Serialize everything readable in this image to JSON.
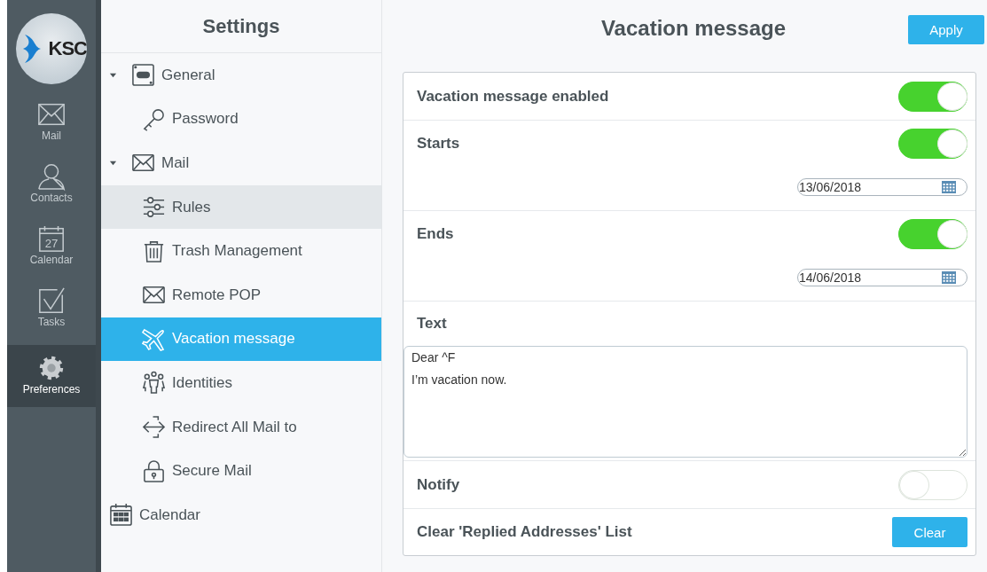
{
  "rail": {
    "logo": "KSC",
    "items": [
      {
        "label": "Mail",
        "kind": "mail",
        "selected": false
      },
      {
        "label": "Contacts",
        "kind": "person",
        "selected": false
      },
      {
        "label": "Calendar",
        "kind": "calendar",
        "day": "27",
        "selected": false
      },
      {
        "label": "Tasks",
        "kind": "check",
        "selected": false
      },
      {
        "label": "Preferences",
        "kind": "gear",
        "selected": true
      }
    ]
  },
  "settings": {
    "title": "Settings",
    "tree": [
      {
        "label": "General",
        "kind": "switch",
        "expanded": true,
        "selected": false,
        "hovered": false,
        "children": [
          {
            "label": "Password",
            "kind": "key",
            "selected": false,
            "hovered": false
          }
        ]
      },
      {
        "label": "Mail",
        "kind": "mail",
        "expanded": true,
        "selected": false,
        "hovered": false,
        "children": [
          {
            "label": "Rules",
            "kind": "sliders",
            "selected": false,
            "hovered": true
          },
          {
            "label": "Trash Management",
            "kind": "trash",
            "selected": false,
            "hovered": false
          },
          {
            "label": "Remote POP",
            "kind": "mail",
            "selected": false,
            "hovered": false
          },
          {
            "label": "Vacation message",
            "kind": "plane",
            "selected": true,
            "hovered": false
          },
          {
            "label": "Identities",
            "kind": "people",
            "selected": false,
            "hovered": false
          },
          {
            "label": "Redirect All Mail to",
            "kind": "arrows",
            "selected": false,
            "hovered": false
          },
          {
            "label": "Secure Mail",
            "kind": "lock",
            "selected": false,
            "hovered": false
          }
        ]
      },
      {
        "label": "Calendar",
        "kind": "grid",
        "selected": false,
        "hovered": false
      }
    ]
  },
  "main": {
    "title": "Vacation message",
    "apply": "Apply",
    "rows": [
      {
        "kind": "toggle",
        "label": "Vacation message enabled",
        "on": true
      },
      {
        "kind": "toggle-date",
        "label": "Starts",
        "on": true,
        "date": "13/06/2018"
      },
      {
        "kind": "toggle-date",
        "label": "Ends",
        "on": true,
        "date": "14/06/2018"
      },
      {
        "kind": "text",
        "label": "Text",
        "value": "Dear ^F\nI’m vacation now."
      },
      {
        "kind": "toggle",
        "label": "Notify",
        "on": false
      },
      {
        "kind": "button",
        "label": "Clear 'Replied Addresses' List",
        "button": "Clear"
      }
    ]
  }
}
